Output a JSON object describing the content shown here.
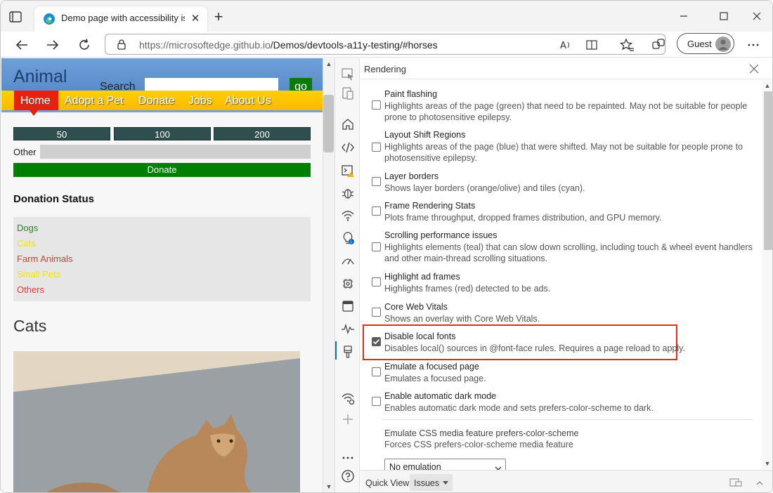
{
  "browser": {
    "tab_title": "Demo page with accessibility issues",
    "url_host": "https://microsoftedge.github.io",
    "url_path": "/Demos/devtools-a11y-testing/#horses",
    "profile_label": "Guest"
  },
  "site": {
    "title": "Animal",
    "search_label": "Search",
    "search_button": "go",
    "nav": [
      "Home",
      "Adopt a Pet",
      "Donate",
      "Jobs",
      "About Us"
    ],
    "amounts": [
      "50",
      "100",
      "200"
    ],
    "other_label": "Other",
    "donate_button": "Donate",
    "donation_status_heading": "Donation Status",
    "status_items": [
      {
        "label": "Dogs",
        "color": "#2e7d32"
      },
      {
        "label": "Cats",
        "color": "#f2e600"
      },
      {
        "label": "Farm Animals",
        "color": "#e53935"
      },
      {
        "label": "Small Pets",
        "color": "#f2e600"
      },
      {
        "label": "Others",
        "color": "#e53935"
      }
    ],
    "cats_heading": "Cats"
  },
  "devtools": {
    "panel_title": "Rendering",
    "options": [
      {
        "title": "Paint flashing",
        "desc": "Highlights areas of the page (green) that need to be repainted. May not be suitable for people prone to photosensitive epilepsy.",
        "checked": false
      },
      {
        "title": "Layout Shift Regions",
        "desc": "Highlights areas of the page (blue) that were shifted. May not be suitable for people prone to photosensitive epilepsy.",
        "checked": false
      },
      {
        "title": "Layer borders",
        "desc": "Shows layer borders (orange/olive) and tiles (cyan).",
        "checked": false
      },
      {
        "title": "Frame Rendering Stats",
        "desc": "Plots frame throughput, dropped frames distribution, and GPU memory.",
        "checked": false
      },
      {
        "title": "Scrolling performance issues",
        "desc": "Highlights elements (teal) that can slow down scrolling, including touch & wheel event handlers and other main-thread scrolling situations.",
        "checked": false
      },
      {
        "title": "Highlight ad frames",
        "desc": "Highlights frames (red) detected to be ads.",
        "checked": false
      },
      {
        "title": "Core Web Vitals",
        "desc": "Shows an overlay with Core Web Vitals.",
        "checked": false
      },
      {
        "title": "Disable local fonts",
        "desc": "Disables local() sources in @font-face rules. Requires a page reload to apply.",
        "checked": true
      },
      {
        "title": "Emulate a focused page",
        "desc": "Emulates a focused page.",
        "checked": false
      },
      {
        "title": "Enable automatic dark mode",
        "desc": "Enables automatic dark mode and sets prefers-color-scheme to dark.",
        "checked": false
      }
    ],
    "media_title": "Emulate CSS media feature prefers-color-scheme",
    "media_desc": "Forces CSS prefers-color-scheme media feature",
    "media_select": "No emulation",
    "quick_view_label": "Quick View:",
    "quick_view_tab": "Issues"
  }
}
